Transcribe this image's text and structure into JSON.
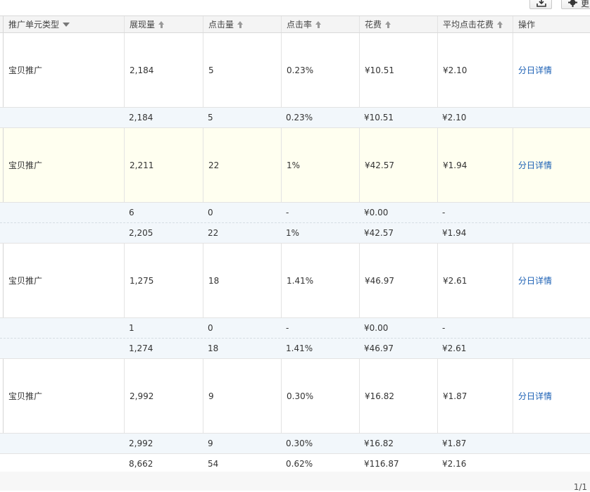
{
  "toolbar": {
    "export_icon": "download-icon",
    "settings_icon": "gear-icon",
    "settings_label": "更"
  },
  "columns": {
    "type": "推广单元类型",
    "impressions": "展现量",
    "clicks": "点击量",
    "ctr": "点击率",
    "cost": "花费",
    "cpc": "平均点击花费",
    "action": "操作"
  },
  "groups": [
    {
      "main": {
        "type": "宝贝推广",
        "impressions": "2,184",
        "clicks": "5",
        "ctr": "0.23%",
        "cost": "¥10.51",
        "cpc": "¥2.10",
        "action": "分日详情",
        "highlight": false
      },
      "subs": [
        {
          "impressions": "2,184",
          "clicks": "5",
          "ctr": "0.23%",
          "cost": "¥10.51",
          "cpc": "¥2.10"
        }
      ]
    },
    {
      "main": {
        "type": "宝贝推广",
        "impressions": "2,211",
        "clicks": "22",
        "ctr": "1%",
        "cost": "¥42.57",
        "cpc": "¥1.94",
        "action": "分日详情",
        "highlight": true
      },
      "subs": [
        {
          "impressions": "6",
          "clicks": "0",
          "ctr": "-",
          "cost": "¥0.00",
          "cpc": "-"
        },
        {
          "impressions": "2,205",
          "clicks": "22",
          "ctr": "1%",
          "cost": "¥42.57",
          "cpc": "¥1.94"
        }
      ]
    },
    {
      "main": {
        "type": "宝贝推广",
        "impressions": "1,275",
        "clicks": "18",
        "ctr": "1.41%",
        "cost": "¥46.97",
        "cpc": "¥2.61",
        "action": "分日详情",
        "highlight": false
      },
      "subs": [
        {
          "impressions": "1",
          "clicks": "0",
          "ctr": "-",
          "cost": "¥0.00",
          "cpc": "-"
        },
        {
          "impressions": "1,274",
          "clicks": "18",
          "ctr": "1.41%",
          "cost": "¥46.97",
          "cpc": "¥2.61"
        }
      ]
    },
    {
      "main": {
        "type": "宝贝推广",
        "impressions": "2,992",
        "clicks": "9",
        "ctr": "0.30%",
        "cost": "¥16.82",
        "cpc": "¥1.87",
        "action": "分日详情",
        "highlight": false
      },
      "subs": [
        {
          "impressions": "2,992",
          "clicks": "9",
          "ctr": "0.30%",
          "cost": "¥16.82",
          "cpc": "¥1.87"
        }
      ]
    }
  ],
  "total": {
    "impressions": "8,662",
    "clicks": "54",
    "ctr": "0.62%",
    "cost": "¥116.87",
    "cpc": "¥2.16"
  },
  "pager": {
    "text": "1/1"
  }
}
